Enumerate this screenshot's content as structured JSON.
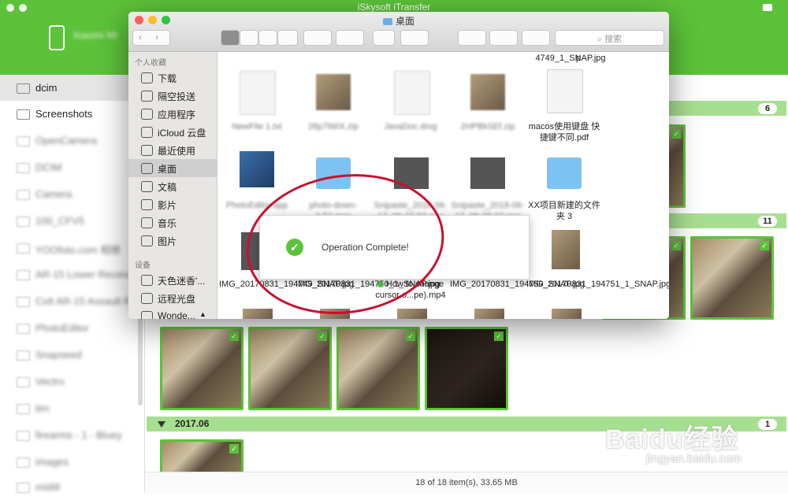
{
  "app": {
    "title": "iSkysoft iTransfer",
    "device_name": "Xiaomi Mi"
  },
  "sidebar": {
    "items": [
      {
        "label": "dcim"
      },
      {
        "label": "Screenshots"
      },
      {
        "label": "OpenCamera"
      },
      {
        "label": "DCIM"
      },
      {
        "label": "Camera"
      },
      {
        "label": "100_CFV5"
      },
      {
        "label": "YOOfoto.com 相册"
      },
      {
        "label": "AR-15 Lower Receiver"
      },
      {
        "label": "Colt AR-15 Assault Rifle"
      },
      {
        "label": "PhotoEditor"
      },
      {
        "label": "Snapseed"
      },
      {
        "label": "Vectro"
      },
      {
        "label": "tim"
      },
      {
        "label": "firearms - 1 - Bluey"
      },
      {
        "label": "images"
      },
      {
        "label": "midi9"
      }
    ]
  },
  "groups": [
    {
      "date": "",
      "count": "6"
    },
    {
      "date": "",
      "count": "11"
    },
    {
      "date": "2017.06",
      "count": "1"
    }
  ],
  "status": {
    "text": "18 of 18 item(s), 33.65 MB"
  },
  "finder": {
    "title": "桌面",
    "search_placeholder": "搜索",
    "sidebar": {
      "favorites_header": "个人收藏",
      "favorites": [
        {
          "label": "下载"
        },
        {
          "label": "隔空投送"
        },
        {
          "label": "应用程序"
        },
        {
          "label": "iCloud 云盘"
        },
        {
          "label": "最近使用"
        },
        {
          "label": "桌面"
        },
        {
          "label": "文稿"
        },
        {
          "label": "影片"
        },
        {
          "label": "音乐"
        },
        {
          "label": "图片"
        }
      ],
      "devices_header": "设备",
      "devices": [
        {
          "label": "天色迷香'..."
        },
        {
          "label": "远程光盘"
        },
        {
          "label": "Wonde..."
        }
      ]
    },
    "files_row0": [
      {
        "label": "p"
      },
      {
        "label": "4749_1_SNAP.jpg"
      }
    ],
    "files_row1": [
      {
        "label": "NewFile 1.txt"
      },
      {
        "label": "28p7iWiX.zip"
      },
      {
        "label": "JavaDoc.dmg"
      },
      {
        "label": "2HPBkSEf.zip"
      },
      {
        "label": "macos使用键盘 快捷键不同.pdf"
      }
    ],
    "files_row2": [
      {
        "label": "PhotoEditor.app"
      },
      {
        "label": "photo-down-2.52.mac"
      },
      {
        "label": "Snipaste_2018-06-17_09-27-52.png"
      },
      {
        "label": "Snipaste_2018-06-17_09-28-07.png"
      },
      {
        "label": "XX项目新建的文件夹 3"
      }
    ],
    "files_row3": [
      {
        "label": "IMG_20170831_194749_SNAP.jpg"
      },
      {
        "label": "IMG_20170831_194750_1_SNAP.jpg"
      },
      {
        "label": "How to change cursor o...pe).mp4"
      },
      {
        "label": "IMG_20170831_194750_SNAP.jpg"
      },
      {
        "label": "IMG_20170831_194751_1_SNAP.jpg"
      }
    ]
  },
  "dialog": {
    "message": "Operation Complete!"
  },
  "watermark": {
    "logo": "Baidu经验",
    "url": "jingyan.baidu.com"
  }
}
